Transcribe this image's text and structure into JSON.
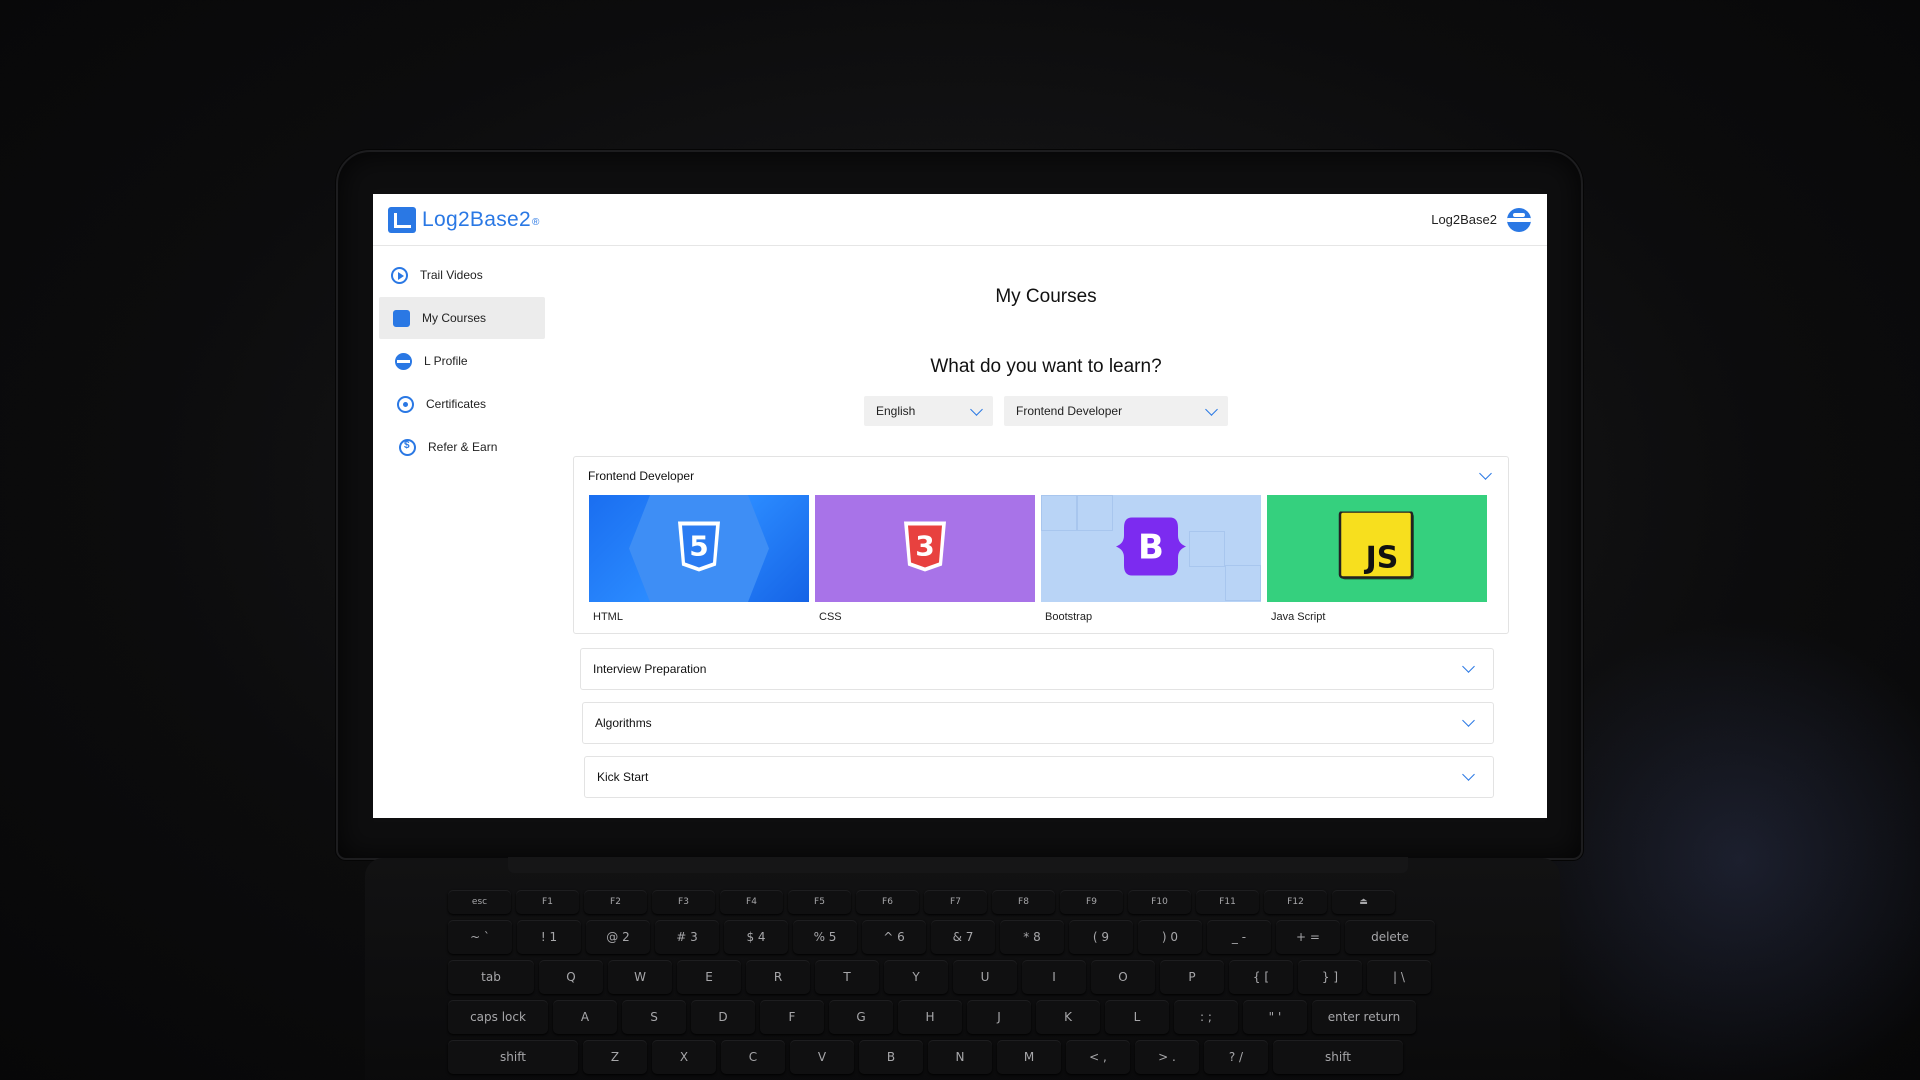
{
  "app": {
    "logo_text": "Log2Base2",
    "logo_mark": "®",
    "user_name": "Log2Base2"
  },
  "sidebar": {
    "items": [
      {
        "label": "Trail Videos",
        "icon": "play-circle-icon",
        "active": false
      },
      {
        "label": "My Courses",
        "icon": "courses-icon",
        "active": true
      },
      {
        "label": "L Profile",
        "icon": "profile-icon",
        "active": false
      },
      {
        "label": "Certificates",
        "icon": "certificate-icon",
        "active": false
      },
      {
        "label": "Refer & Earn",
        "icon": "dollar-icon",
        "active": false
      }
    ]
  },
  "main": {
    "title": "My Courses",
    "question": "What do you want to learn?",
    "language_select": {
      "value": "English"
    },
    "track_select": {
      "value": "Frontend Developer"
    },
    "expanded_section": {
      "title": "Frontend Developer",
      "courses": [
        {
          "label": "HTML",
          "badge": "5"
        },
        {
          "label": "CSS",
          "badge": "3"
        },
        {
          "label": "Bootstrap",
          "badge": "B"
        },
        {
          "label": "Java Script",
          "badge": "JS"
        }
      ]
    },
    "sections": [
      {
        "title": "Interview Preparation"
      },
      {
        "title": "Algorithms"
      },
      {
        "title": "Kick Start"
      }
    ]
  },
  "keyboard": {
    "fn_row": [
      "esc",
      "F1",
      "F2",
      "F3",
      "F4",
      "F5",
      "F6",
      "F7",
      "F8",
      "F9",
      "F10",
      "F11",
      "F12",
      "⏏"
    ],
    "num_row": [
      "~ `",
      "! 1",
      "@ 2",
      "# 3",
      "$ 4",
      "% 5",
      "^ 6",
      "& 7",
      "* 8",
      "( 9",
      ") 0",
      "_ -",
      "+ =",
      "delete"
    ],
    "q_row": [
      "tab",
      "Q",
      "W",
      "E",
      "R",
      "T",
      "Y",
      "U",
      "I",
      "O",
      "P",
      "{ [",
      "} ]",
      "| \\"
    ],
    "a_row": [
      "caps lock",
      "A",
      "S",
      "D",
      "F",
      "G",
      "H",
      "J",
      "K",
      "L",
      ": ;",
      "\" '",
      "enter return"
    ],
    "z_row": [
      "shift",
      "Z",
      "X",
      "C",
      "V",
      "B",
      "N",
      "M",
      "< ,",
      "> .",
      "? /",
      "shift"
    ]
  },
  "colors": {
    "accent": "#2a78e4",
    "html": "#1a6ef0",
    "css": "#a873e8",
    "bootstrap": "#b9d4f6",
    "javascript": "#35d07e"
  }
}
